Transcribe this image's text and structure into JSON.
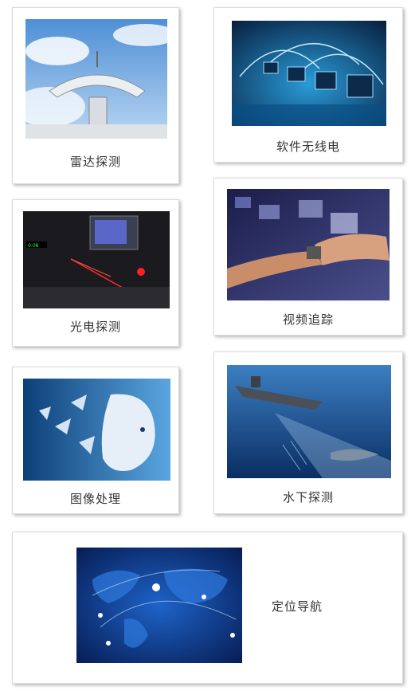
{
  "cards": [
    {
      "id": "radar",
      "label": "雷达探测",
      "icon": "radar-dish-image"
    },
    {
      "id": "software-radio",
      "label": "软件无线电",
      "icon": "network-laptops-image"
    },
    {
      "id": "electro-optical",
      "label": "光电探测",
      "icon": "laser-lab-image"
    },
    {
      "id": "video-tracking",
      "label": "视频追踪",
      "icon": "hologram-wrist-image"
    },
    {
      "id": "image-processing",
      "label": "图像处理",
      "icon": "ai-face-image"
    },
    {
      "id": "underwater",
      "label": "水下探测",
      "icon": "submarine-sonar-image"
    },
    {
      "id": "navigation",
      "label": "定位导航",
      "icon": "world-map-pins-image"
    }
  ],
  "colors": {
    "label_text": "#333333",
    "card_border": "#dcdcdc"
  }
}
